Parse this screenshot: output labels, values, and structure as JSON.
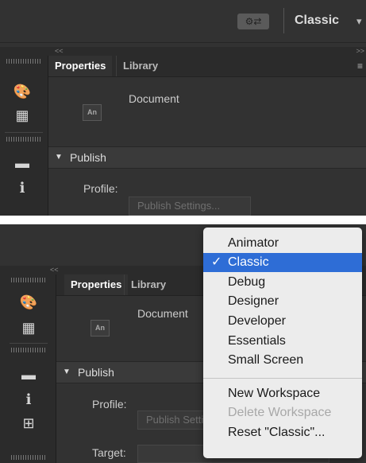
{
  "top_bar": {
    "workspace_icon": "workspace-layout-icon",
    "workspace_label": "Classic",
    "caret": "▾"
  },
  "collapse": {
    "left": "<<",
    "right": ">>"
  },
  "tabs": {
    "properties": "Properties",
    "library": "Library"
  },
  "panel_menu_icon": "≡",
  "document": {
    "label": "Document",
    "icon_text": "An"
  },
  "publish": {
    "header": "Publish",
    "profile_label": "Profile:",
    "settings_button": "Publish Settings...",
    "target_label": "Target:"
  },
  "workspace_menu": {
    "items": [
      {
        "label": "Animator",
        "selected": false,
        "disabled": false
      },
      {
        "label": "Classic",
        "selected": true,
        "disabled": false,
        "check": "✓"
      },
      {
        "label": "Debug",
        "selected": false,
        "disabled": false
      },
      {
        "label": "Designer",
        "selected": false,
        "disabled": false
      },
      {
        "label": "Developer",
        "selected": false,
        "disabled": false
      },
      {
        "label": "Essentials",
        "selected": false,
        "disabled": false
      },
      {
        "label": "Small Screen",
        "selected": false,
        "disabled": false
      },
      {
        "label": "New Workspace",
        "selected": false,
        "disabled": false
      },
      {
        "label": "Delete Workspace",
        "selected": false,
        "disabled": true
      },
      {
        "label": "Reset \"Classic\"...",
        "selected": false,
        "disabled": false
      }
    ]
  },
  "colors": {
    "panel_bg": "#323232",
    "menu_bg": "#ececec",
    "menu_highlight": "#2e6dd6"
  }
}
